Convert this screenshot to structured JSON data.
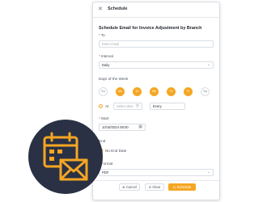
{
  "dialog": {
    "title": "Schedule",
    "heading": "Schedule Email for Invoice Adjustment by Branch"
  },
  "to": {
    "label": "To",
    "placeholder": "Enter email"
  },
  "interval": {
    "label": "Interval",
    "value": "Daily"
  },
  "days": {
    "label": "Days of the Week",
    "items": [
      {
        "label": "Su",
        "selected": false
      },
      {
        "label": "Mo",
        "selected": true
      },
      {
        "label": "Tu",
        "selected": true
      },
      {
        "label": "We",
        "selected": true
      },
      {
        "label": "Th",
        "selected": true
      },
      {
        "label": "Fr",
        "selected": true
      },
      {
        "label": "Sa",
        "selected": false
      }
    ]
  },
  "at": {
    "label": "At",
    "time_placeholder": "Select time",
    "every_label": "Every"
  },
  "start": {
    "label": "Start",
    "value": "10/18/2024 08:00"
  },
  "end": {
    "label": "End",
    "no_end_label": "No End Date",
    "no_end_checked": true
  },
  "format": {
    "label": "Format",
    "value": "PDF"
  },
  "buttons": {
    "cancel": "Cancel",
    "clear": "Clear",
    "schedule": "Schedule"
  },
  "colors": {
    "accent": "#f5a623",
    "badge_bg": "#2a3144"
  },
  "icons": {
    "badge": "calendar-envelope-icon"
  }
}
